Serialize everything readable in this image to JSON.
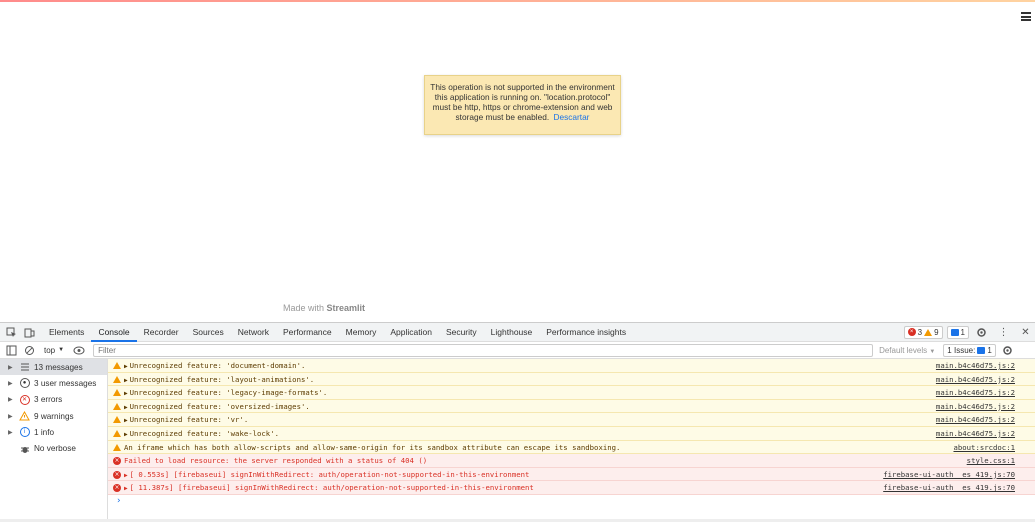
{
  "page": {
    "alert_text": "This operation is not supported in the environment this application is running on. \"location.protocol\" must be http, https or chrome-extension and web storage must be enabled.",
    "alert_link": "Descartar",
    "made_with_prefix": "Made with ",
    "made_with_brand": "Streamlit"
  },
  "devtools": {
    "tabs": [
      "Elements",
      "Console",
      "Recorder",
      "Sources",
      "Network",
      "Performance",
      "Memory",
      "Application",
      "Security",
      "Lighthouse",
      "Performance insights"
    ],
    "active_tab": "Console",
    "badges": {
      "errors": "3",
      "warnings": "9",
      "info": "1"
    },
    "toolbar": {
      "context": "top",
      "filter_placeholder": "Filter",
      "levels": "Default levels",
      "issues_label": "1 Issue:",
      "issues_count": "1"
    },
    "sidebar": [
      {
        "label": "13 messages",
        "icon": "list-icon"
      },
      {
        "label": "3 user messages",
        "icon": "user-icon"
      },
      {
        "label": "3 errors",
        "icon": "error-icon"
      },
      {
        "label": "9 warnings",
        "icon": "warning-icon"
      },
      {
        "label": "1 info",
        "icon": "info-icon"
      },
      {
        "label": "No verbose",
        "icon": "bug-icon"
      }
    ],
    "messages": [
      {
        "level": "warn",
        "text": "Unrecognized feature: 'document-domain'.",
        "source": "main.b4c46d75.js:2",
        "expand": true
      },
      {
        "level": "warn",
        "text": "Unrecognized feature: 'layout-animations'.",
        "source": "main.b4c46d75.js:2",
        "expand": true
      },
      {
        "level": "warn",
        "text": "Unrecognized feature: 'legacy-image-formats'.",
        "source": "main.b4c46d75.js:2",
        "expand": true
      },
      {
        "level": "warn",
        "text": "Unrecognized feature: 'oversized-images'.",
        "source": "main.b4c46d75.js:2",
        "expand": true
      },
      {
        "level": "warn",
        "text": "Unrecognized feature: 'vr'.",
        "source": "main.b4c46d75.js:2",
        "expand": true
      },
      {
        "level": "warn",
        "text": "Unrecognized feature: 'wake-lock'.",
        "source": "main.b4c46d75.js:2",
        "expand": true
      },
      {
        "level": "warn",
        "text": "An iframe which has both allow-scripts and allow-same-origin for its sandbox attribute can escape its sandboxing.",
        "source": "about:srcdoc:1",
        "expand": false
      },
      {
        "level": "err",
        "text": "Failed to load resource: the server responded with a status of 404 ()",
        "source": "style.css:1",
        "expand": false
      },
      {
        "level": "err",
        "text": "[  0.553s] [firebaseui] signInWithRedirect: auth/operation-not-supported-in-this-environment",
        "source": "firebase-ui-auth__es_419.js:70",
        "expand": true
      },
      {
        "level": "err",
        "text": "[ 11.387s] [firebaseui] signInWithRedirect: auth/operation-not-supported-in-this-environment",
        "source": "firebase-ui-auth__es_419.js:70",
        "expand": true
      }
    ],
    "prompt": "›"
  },
  "colors": {
    "accent": "#1a73e8",
    "error": "#d93025",
    "warning": "#f29900",
    "alert_bg": "#fbe8b3"
  }
}
